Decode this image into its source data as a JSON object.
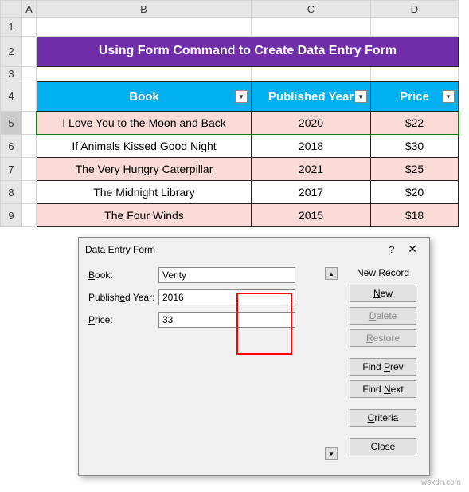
{
  "columns": {
    "A": "A",
    "B": "B",
    "C": "C",
    "D": "D"
  },
  "rows": [
    "1",
    "2",
    "3",
    "4",
    "5",
    "6",
    "7",
    "8",
    "9"
  ],
  "title": "Using Form Command to Create Data Entry Form",
  "table": {
    "headers": {
      "book": "Book",
      "year": "Published Year",
      "price": "Price"
    },
    "data": [
      {
        "book": "I Love You to the Moon and Back",
        "year": "2020",
        "price": "$22"
      },
      {
        "book": "If Animals Kissed Good Night",
        "year": "2018",
        "price": "$30"
      },
      {
        "book": "The Very Hungry Caterpillar",
        "year": "2021",
        "price": "$25"
      },
      {
        "book": "The Midnight Library",
        "year": "2017",
        "price": "$20"
      },
      {
        "book": "The Four Winds",
        "year": "2015",
        "price": "$18"
      }
    ]
  },
  "dialog": {
    "title": "Data Entry Form",
    "help": "?",
    "close": "✕",
    "record_status": "New Record",
    "fields": {
      "book_label": "Book:",
      "year_label": "Published Year:",
      "price_label": "Price:",
      "book_value": "Verity",
      "year_value": "2016",
      "price_value": "33"
    },
    "buttons": {
      "new": "New",
      "delete": "Delete",
      "restore": "Restore",
      "find_prev": "Find Prev",
      "find_next": "Find Next",
      "criteria": "Criteria",
      "close": "Close"
    }
  },
  "watermark": "wsxdn.com"
}
